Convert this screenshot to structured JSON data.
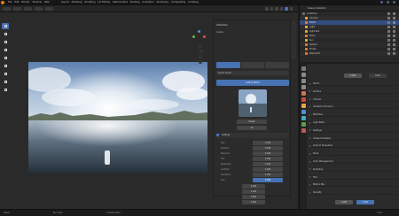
{
  "menu": [
    "File",
    "Edit",
    "Render",
    "Window",
    "Help",
    "Layout",
    "Modeling",
    "Sculpting",
    "UV Editing",
    "Texture Paint",
    "Shading",
    "Animation",
    "Rendering",
    "Compositing",
    "Scripting"
  ],
  "outliner": {
    "title": "Scene Collection",
    "rows": [
      {
        "label": "Collection",
        "indent": 3,
        "color": "#c8c8c8",
        "icon": "#6d6d6d"
      },
      {
        "label": "Camera",
        "indent": 6,
        "color": "#c8c8c8",
        "icon": "#e8a642"
      },
      {
        "label": "World",
        "indent": 6,
        "color": "#dfe7ff",
        "icon": "#e07a30",
        "selected": true
      },
      {
        "label": "Light",
        "indent": 6,
        "color": "#c8c8c8",
        "icon": "#e8a642"
      },
      {
        "label": "Light.001",
        "indent": 6,
        "color": "#c8c8c8",
        "icon": "#e8a642"
      },
      {
        "label": "Plane",
        "indent": 6,
        "color": "#c8c8c8",
        "icon": "#e07a30"
      },
      {
        "label": "Sun",
        "indent": 6,
        "color": "#c8c8c8",
        "icon": "#e8a642"
      },
      {
        "label": "Sphere",
        "indent": 6,
        "color": "#c8c8c8",
        "icon": "#e07a30"
      },
      {
        "label": "Empty",
        "indent": 6,
        "color": "#c8c8c8",
        "icon": "#e07a30"
      },
      {
        "label": "Plane.001",
        "indent": 6,
        "color": "#c8c8c8",
        "icon": "#e07a30"
      }
    ]
  },
  "npanel": {
    "title": "Collection",
    "subtitle": "Assets",
    "segments": [
      "HDRI",
      "Textures",
      "Models"
    ],
    "row_a": "Select Preset",
    "button": "Add to World",
    "thumb_caption": "Ocean",
    "resolution": "1K",
    "section": "Settings",
    "fields": [
      {
        "label": "Size",
        "value": "1.000",
        "blue": false
      },
      {
        "label": "Rotation",
        "value": "0.000",
        "blue": false
      },
      {
        "label": "Exposure",
        "value": "0.000",
        "blue": false
      },
      {
        "label": "Tint",
        "value": "0.000",
        "blue": false
      },
      {
        "label": "Brightness",
        "value": "1.000",
        "blue": false
      },
      {
        "label": "Contrast",
        "value": "0.000",
        "blue": false
      },
      {
        "label": "Saturation",
        "value": "1.000",
        "blue": false
      },
      {
        "label": "Hue",
        "value": "0.000",
        "blue": true
      }
    ],
    "lower_fields": [
      "0.000",
      "1.000",
      "0.000",
      "0.000"
    ]
  },
  "properties": {
    "sections": [
      "World",
      "Surface",
      "Volume",
      "Ambient Occlusion",
      "Mist Pass",
      "Light Paths",
      "Settings",
      "Viewport Display",
      "Custom Properties",
      "Node",
      "Color Management",
      "Sampling",
      "Film",
      "Motion Blur",
      "Simplify"
    ],
    "field_top_a": "0.000",
    "field_top_b": "Color",
    "field_bottom_a": "1.000",
    "field_bottom_b": "0.000"
  },
  "status": {
    "left": "Select",
    "mid": "Pan View",
    "right": "Context Menu",
    "version": "3.6.2"
  }
}
